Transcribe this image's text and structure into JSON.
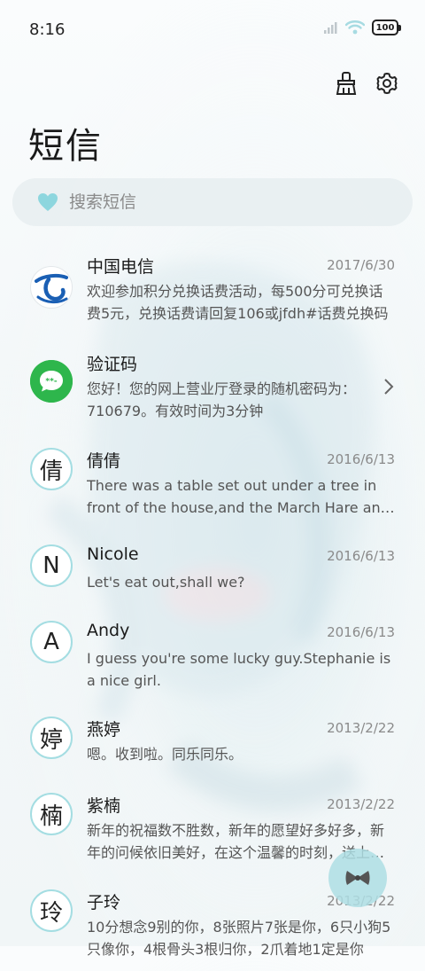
{
  "status_bar": {
    "time": "8:16",
    "battery": "100"
  },
  "header": {
    "title": "短信"
  },
  "search": {
    "placeholder": "搜索短信"
  },
  "messages": [
    {
      "sender": "中国电信",
      "date": "2017/6/30",
      "preview": "欢迎参加积分兑换话费活动，每500分可兑换话费5元，兑换话费请回复106或jfdh#话费兑换码",
      "avatar": "telecom-logo"
    },
    {
      "sender": "验证码",
      "date": "",
      "preview": "您好！您的网上营业厅登录的随机密码为：710679。有效时间为3分钟",
      "avatar": "sms-code-icon"
    },
    {
      "sender": "倩倩",
      "date": "2016/6/13",
      "preview": "There was a table set out under a tree in front of the house,and the March Hare and the Hatter",
      "avatar_letter": "倩"
    },
    {
      "sender": "Nicole",
      "date": "2016/6/13",
      "preview": "Let's eat out,shall we?",
      "avatar_letter": "N"
    },
    {
      "sender": "Andy",
      "date": "2016/6/13",
      "preview": "I guess you're some lucky guy.Stephanie is a nice girl.",
      "avatar_letter": "A"
    },
    {
      "sender": "燕婷",
      "date": "2013/2/22",
      "preview": "嗯。收到啦。同乐同乐。",
      "avatar_letter": "婷"
    },
    {
      "sender": "紫楠",
      "date": "2013/2/22",
      "preview": "新年的祝福数不胜数，新年的愿望好多好多，新年的问候依旧美好，在这个温馨的时刻，送上我的祝福",
      "avatar_letter": "楠"
    },
    {
      "sender": "子玲",
      "date": "2013/2/22",
      "preview": "10分想念9别的你，8张照片7张是你，6只小狗5只像你，4根骨头3根归你，2爪着地1定是你",
      "avatar_letter": "玲"
    }
  ],
  "colors": {
    "accent": "#a4dde2",
    "telecom_blue": "#1a5fb4",
    "sms_green": "#2eb64c"
  }
}
